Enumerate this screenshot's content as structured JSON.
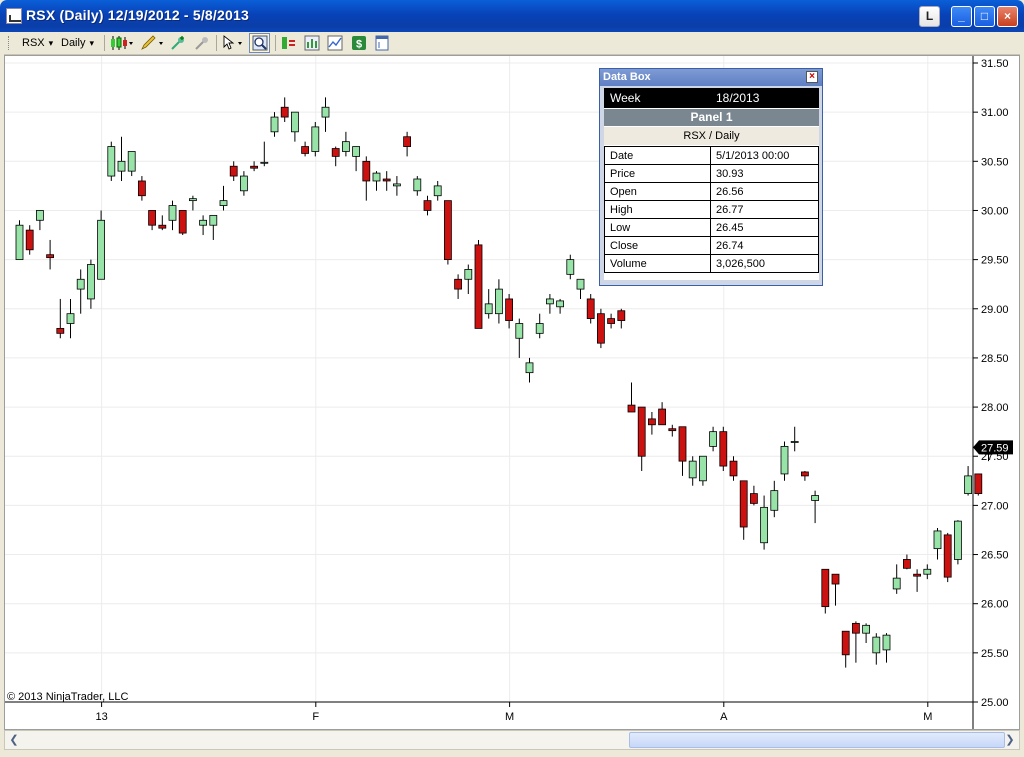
{
  "window": {
    "title": "RSX (Daily)  12/19/2012 - 5/8/2013",
    "link_button_label": "L",
    "minimize_label": "_",
    "maximize_label": "□",
    "close_label": "×"
  },
  "toolbar": {
    "instrument": "RSX",
    "interval": "Daily",
    "icons": [
      "candlestick-style-icon",
      "pencil-draw-icon",
      "add-indicator-icon",
      "remove-indicator-icon",
      "cursor-pointer-icon",
      "zoom-icon",
      "strategies-icon",
      "bar-chart-icon",
      "data-series-icon",
      "dollar-icon",
      "properties-icon"
    ]
  },
  "chart": {
    "copyright": "© 2013 NinjaTrader, LLC",
    "last_price_label": "27.59",
    "colors": {
      "up": "#98e3a8",
      "down": "#cc1111",
      "wick": "#000000",
      "grid": "#ececec"
    }
  },
  "databox": {
    "title": "Data Box",
    "week_label": "Week",
    "week_value": "18/2013",
    "panel": "Panel 1",
    "instrument": "RSX / Daily",
    "rows": [
      {
        "label": "Date",
        "value": "5/1/2013 00:00"
      },
      {
        "label": "Price",
        "value": "30.93"
      },
      {
        "label": "Open",
        "value": "26.56"
      },
      {
        "label": "High",
        "value": "26.77"
      },
      {
        "label": "Low",
        "value": "26.45"
      },
      {
        "label": "Close",
        "value": "26.74"
      },
      {
        "label": "Volume",
        "value": "3,026,500"
      }
    ]
  },
  "chart_data": {
    "type": "candlestick",
    "title": "RSX (Daily)  12/19/2012 - 5/8/2013",
    "x_tick_labels": [
      "13",
      "F",
      "M",
      "A",
      "M"
    ],
    "y_tick_labels": [
      "31.50",
      "31.00",
      "30.50",
      "30.00",
      "29.50",
      "29.00",
      "28.50",
      "28.00",
      "27.50",
      "27.00",
      "26.50",
      "26.00",
      "25.50",
      "25.00"
    ],
    "ylim": [
      25.0,
      31.5
    ],
    "last_price": 27.59,
    "grid": true,
    "candles": [
      {
        "o": 29.5,
        "h": 29.9,
        "l": 29.5,
        "c": 29.85
      },
      {
        "o": 29.8,
        "h": 29.85,
        "l": 29.55,
        "c": 29.6
      },
      {
        "o": 29.9,
        "h": 30.0,
        "l": 29.8,
        "c": 30.0
      },
      {
        "o": 29.55,
        "h": 29.7,
        "l": 29.4,
        "c": 29.52
      },
      {
        "o": 28.8,
        "h": 29.1,
        "l": 28.7,
        "c": 28.75
      },
      {
        "o": 28.85,
        "h": 29.1,
        "l": 28.7,
        "c": 28.95
      },
      {
        "o": 29.2,
        "h": 29.4,
        "l": 28.95,
        "c": 29.3
      },
      {
        "o": 29.1,
        "h": 29.5,
        "l": 29.0,
        "c": 29.45
      },
      {
        "o": 29.3,
        "h": 30.0,
        "l": 29.3,
        "c": 29.9
      },
      {
        "o": 30.35,
        "h": 30.7,
        "l": 30.3,
        "c": 30.65
      },
      {
        "o": 30.4,
        "h": 30.75,
        "l": 30.3,
        "c": 30.5
      },
      {
        "o": 30.4,
        "h": 30.6,
        "l": 30.35,
        "c": 30.6
      },
      {
        "o": 30.3,
        "h": 30.35,
        "l": 30.1,
        "c": 30.15
      },
      {
        "o": 30.0,
        "h": 30.0,
        "l": 29.8,
        "c": 29.85
      },
      {
        "o": 29.85,
        "h": 29.95,
        "l": 29.8,
        "c": 29.82
      },
      {
        "o": 29.9,
        "h": 30.1,
        "l": 29.8,
        "c": 30.05
      },
      {
        "o": 30.0,
        "h": 30.0,
        "l": 29.75,
        "c": 29.77
      },
      {
        "o": 30.1,
        "h": 30.15,
        "l": 30.0,
        "c": 30.12
      },
      {
        "o": 29.85,
        "h": 29.95,
        "l": 29.75,
        "c": 29.9
      },
      {
        "o": 29.85,
        "h": 29.95,
        "l": 29.7,
        "c": 29.95
      },
      {
        "o": 30.05,
        "h": 30.25,
        "l": 30.0,
        "c": 30.1
      },
      {
        "o": 30.45,
        "h": 30.5,
        "l": 30.3,
        "c": 30.35
      },
      {
        "o": 30.2,
        "h": 30.4,
        "l": 30.15,
        "c": 30.35
      },
      {
        "o": 30.45,
        "h": 30.5,
        "l": 30.4,
        "c": 30.43
      },
      {
        "o": 30.48,
        "h": 30.7,
        "l": 30.45,
        "c": 30.49
      },
      {
        "o": 30.8,
        "h": 31.0,
        "l": 30.75,
        "c": 30.95
      },
      {
        "o": 31.05,
        "h": 31.15,
        "l": 30.9,
        "c": 30.95
      },
      {
        "o": 30.8,
        "h": 31.0,
        "l": 30.7,
        "c": 31.0
      },
      {
        "o": 30.65,
        "h": 30.7,
        "l": 30.55,
        "c": 30.58
      },
      {
        "o": 30.6,
        "h": 30.9,
        "l": 30.55,
        "c": 30.85
      },
      {
        "o": 30.95,
        "h": 31.15,
        "l": 30.8,
        "c": 31.05
      },
      {
        "o": 30.63,
        "h": 30.65,
        "l": 30.45,
        "c": 30.55
      },
      {
        "o": 30.6,
        "h": 30.8,
        "l": 30.55,
        "c": 30.7
      },
      {
        "o": 30.55,
        "h": 30.65,
        "l": 30.4,
        "c": 30.65
      },
      {
        "o": 30.5,
        "h": 30.55,
        "l": 30.1,
        "c": 30.3
      },
      {
        "o": 30.3,
        "h": 30.4,
        "l": 30.2,
        "c": 30.38
      },
      {
        "o": 30.32,
        "h": 30.4,
        "l": 30.2,
        "c": 30.3
      },
      {
        "o": 30.25,
        "h": 30.35,
        "l": 30.15,
        "c": 30.27
      },
      {
        "o": 30.75,
        "h": 30.8,
        "l": 30.55,
        "c": 30.65
      },
      {
        "o": 30.2,
        "h": 30.35,
        "l": 30.15,
        "c": 30.32
      },
      {
        "o": 30.1,
        "h": 30.15,
        "l": 29.95,
        "c": 30.0
      },
      {
        "o": 30.15,
        "h": 30.3,
        "l": 30.1,
        "c": 30.25
      },
      {
        "o": 30.1,
        "h": 30.1,
        "l": 29.45,
        "c": 29.5
      },
      {
        "o": 29.3,
        "h": 29.35,
        "l": 29.1,
        "c": 29.2
      },
      {
        "o": 29.3,
        "h": 29.45,
        "l": 29.15,
        "c": 29.4
      },
      {
        "o": 29.65,
        "h": 29.7,
        "l": 28.8,
        "c": 28.8
      },
      {
        "o": 28.95,
        "h": 29.2,
        "l": 28.9,
        "c": 29.05
      },
      {
        "o": 28.95,
        "h": 29.3,
        "l": 28.85,
        "c": 29.2
      },
      {
        "o": 29.1,
        "h": 29.15,
        "l": 28.8,
        "c": 28.88
      },
      {
        "o": 28.7,
        "h": 28.9,
        "l": 28.5,
        "c": 28.85
      },
      {
        "o": 28.35,
        "h": 28.5,
        "l": 28.25,
        "c": 28.45
      },
      {
        "o": 28.75,
        "h": 28.95,
        "l": 28.7,
        "c": 28.85
      },
      {
        "o": 29.05,
        "h": 29.15,
        "l": 28.95,
        "c": 29.1
      },
      {
        "o": 29.02,
        "h": 29.1,
        "l": 28.95,
        "c": 29.08
      },
      {
        "o": 29.35,
        "h": 29.55,
        "l": 29.3,
        "c": 29.5
      },
      {
        "o": 29.2,
        "h": 29.3,
        "l": 29.1,
        "c": 29.3
      },
      {
        "o": 29.1,
        "h": 29.15,
        "l": 28.85,
        "c": 28.9
      },
      {
        "o": 28.95,
        "h": 29.0,
        "l": 28.6,
        "c": 28.65
      },
      {
        "o": 28.9,
        "h": 28.95,
        "l": 28.8,
        "c": 28.85
      },
      {
        "o": 28.98,
        "h": 29.0,
        "l": 28.8,
        "c": 28.88
      },
      {
        "o": 28.02,
        "h": 28.25,
        "l": 27.95,
        "c": 27.95
      },
      {
        "o": 28.0,
        "h": 28.0,
        "l": 27.35,
        "c": 27.5
      },
      {
        "o": 27.88,
        "h": 27.95,
        "l": 27.72,
        "c": 27.82
      },
      {
        "o": 27.98,
        "h": 28.05,
        "l": 27.82,
        "c": 27.82
      },
      {
        "o": 27.78,
        "h": 27.82,
        "l": 27.7,
        "c": 27.76
      },
      {
        "o": 27.8,
        "h": 27.8,
        "l": 27.3,
        "c": 27.45
      },
      {
        "o": 27.28,
        "h": 27.5,
        "l": 27.2,
        "c": 27.45
      },
      {
        "o": 27.25,
        "h": 27.5,
        "l": 27.2,
        "c": 27.5
      },
      {
        "o": 27.6,
        "h": 27.8,
        "l": 27.55,
        "c": 27.75
      },
      {
        "o": 27.75,
        "h": 27.8,
        "l": 27.35,
        "c": 27.4
      },
      {
        "o": 27.45,
        "h": 27.5,
        "l": 27.25,
        "c": 27.3
      },
      {
        "o": 27.25,
        "h": 27.25,
        "l": 26.65,
        "c": 26.78
      },
      {
        "o": 27.12,
        "h": 27.2,
        "l": 27.0,
        "c": 27.02
      },
      {
        "o": 26.62,
        "h": 27.1,
        "l": 26.55,
        "c": 26.98
      },
      {
        "o": 26.95,
        "h": 27.25,
        "l": 26.88,
        "c": 27.15
      },
      {
        "o": 27.32,
        "h": 27.65,
        "l": 27.25,
        "c": 27.6
      },
      {
        "o": 27.65,
        "h": 27.8,
        "l": 27.55,
        "c": 27.65
      },
      {
        "o": 27.34,
        "h": 27.35,
        "l": 27.25,
        "c": 27.3
      },
      {
        "o": 27.05,
        "h": 27.15,
        "l": 26.82,
        "c": 27.1
      },
      {
        "o": 26.35,
        "h": 26.35,
        "l": 25.9,
        "c": 25.97
      },
      {
        "o": 26.3,
        "h": 26.3,
        "l": 25.98,
        "c": 26.2
      },
      {
        "o": 25.72,
        "h": 25.72,
        "l": 25.35,
        "c": 25.48
      },
      {
        "o": 25.8,
        "h": 25.82,
        "l": 25.4,
        "c": 25.7
      },
      {
        "o": 25.7,
        "h": 25.8,
        "l": 25.6,
        "c": 25.78
      },
      {
        "o": 25.5,
        "h": 25.7,
        "l": 25.38,
        "c": 25.66
      },
      {
        "o": 25.53,
        "h": 25.7,
        "l": 25.4,
        "c": 25.68
      },
      {
        "o": 26.15,
        "h": 26.4,
        "l": 26.1,
        "c": 26.26
      },
      {
        "o": 26.45,
        "h": 26.5,
        "l": 26.35,
        "c": 26.36
      },
      {
        "o": 26.3,
        "h": 26.35,
        "l": 26.12,
        "c": 26.28
      },
      {
        "o": 26.3,
        "h": 26.4,
        "l": 26.25,
        "c": 26.35
      },
      {
        "o": 26.56,
        "h": 26.77,
        "l": 26.45,
        "c": 26.74
      },
      {
        "o": 26.7,
        "h": 26.72,
        "l": 26.22,
        "c": 26.27
      },
      {
        "o": 26.45,
        "h": 26.85,
        "l": 26.4,
        "c": 26.84
      },
      {
        "o": 27.12,
        "h": 27.4,
        "l": 27.1,
        "c": 27.3
      },
      {
        "o": 27.32,
        "h": 27.32,
        "l": 27.1,
        "c": 27.12
      },
      {
        "o": 27.52,
        "h": 27.62,
        "l": 27.45,
        "c": 27.59
      }
    ]
  }
}
